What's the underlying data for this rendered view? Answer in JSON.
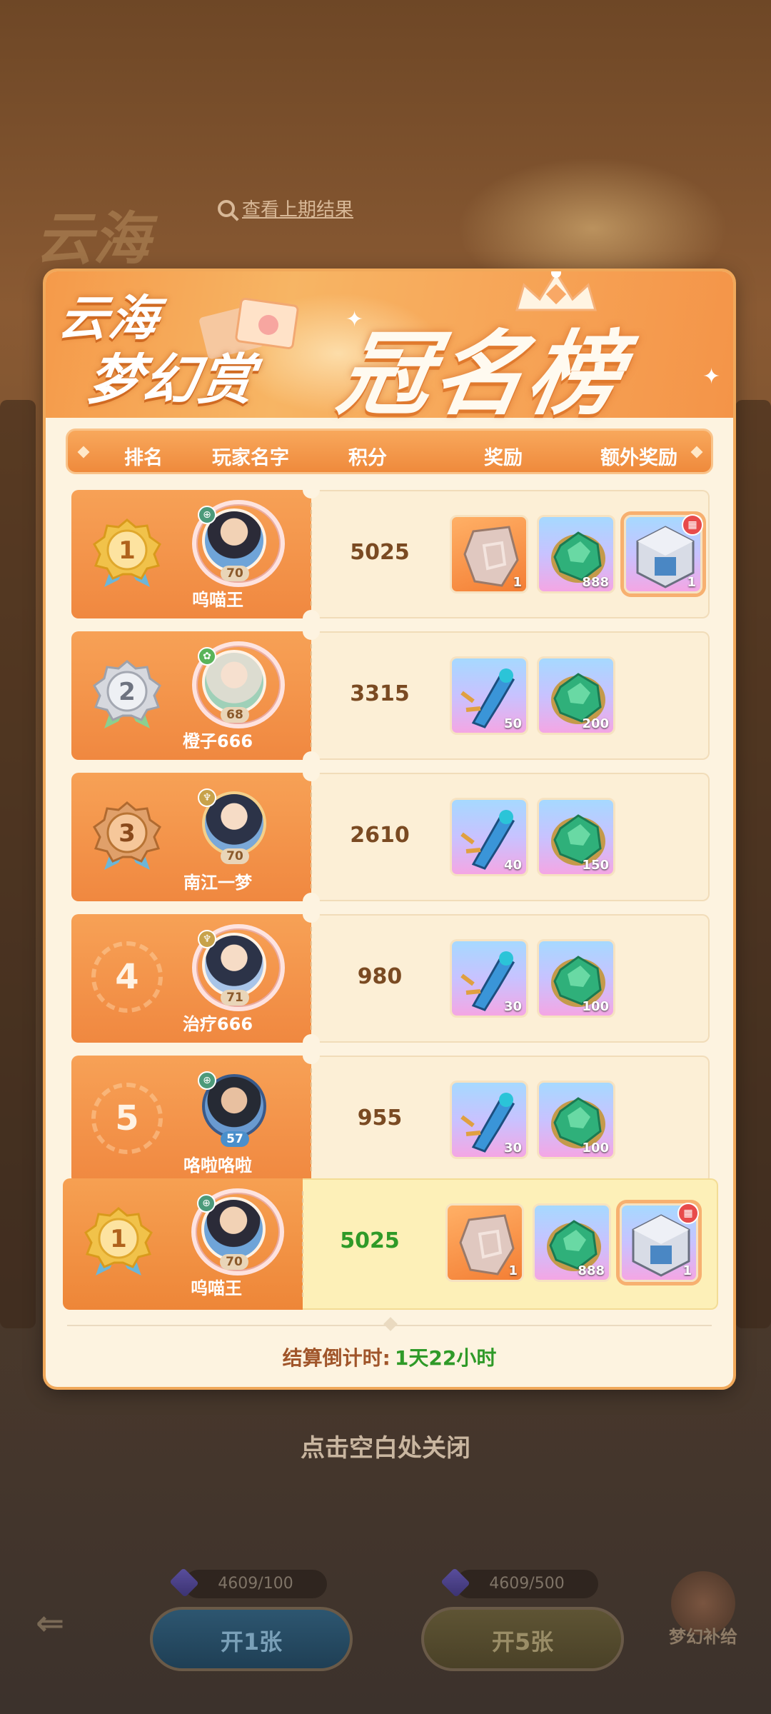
{
  "background": {
    "title": "云海",
    "history_link": "查看上期结果"
  },
  "banner": {
    "line1": "云海",
    "line2": "梦幻赏",
    "main": "冠名榜"
  },
  "table": {
    "headers": [
      "排名",
      "玩家名字",
      "积分",
      "奖励",
      "额外奖励"
    ]
  },
  "rows": [
    {
      "rank": "1",
      "name": "呜喵王",
      "level": "70",
      "score": "5025",
      "rewards": [
        {
          "icon": "rune-stone-icon",
          "qty": "1",
          "bg": "orange"
        },
        {
          "icon": "emerald-gem-icon",
          "qty": "888",
          "bg": "purple"
        }
      ],
      "extra": {
        "icon": "mecha-cube-icon",
        "qty": "1",
        "bg": "purple"
      }
    },
    {
      "rank": "2",
      "name": "橙子666",
      "level": "68",
      "score": "3315",
      "rewards": [
        {
          "icon": "mecha-claw-icon",
          "qty": "50",
          "bg": "purple"
        },
        {
          "icon": "emerald-gem-icon",
          "qty": "200",
          "bg": "purple"
        }
      ]
    },
    {
      "rank": "3",
      "name": "南江一梦",
      "level": "70",
      "score": "2610",
      "rewards": [
        {
          "icon": "mecha-claw-icon",
          "qty": "40",
          "bg": "purple"
        },
        {
          "icon": "emerald-gem-icon",
          "qty": "150",
          "bg": "purple"
        }
      ]
    },
    {
      "rank": "4",
      "name": "治疗666",
      "level": "71",
      "score": "980",
      "rewards": [
        {
          "icon": "mecha-claw-icon",
          "qty": "30",
          "bg": "purple"
        },
        {
          "icon": "emerald-gem-icon",
          "qty": "100",
          "bg": "purple"
        }
      ]
    },
    {
      "rank": "5",
      "name": "咯啦咯啦",
      "level": "57",
      "score": "955",
      "rewards": [
        {
          "icon": "mecha-claw-icon",
          "qty": "30",
          "bg": "purple"
        },
        {
          "icon": "emerald-gem-icon",
          "qty": "100",
          "bg": "purple"
        }
      ]
    }
  ],
  "my_row": {
    "rank": "1",
    "name": "呜喵王",
    "level": "70",
    "score": "5025",
    "rewards": [
      {
        "qty": "1"
      },
      {
        "qty": "888"
      }
    ],
    "extra_qty": "1"
  },
  "countdown": {
    "label": "结算倒计时:",
    "value": "1天22小时"
  },
  "close_hint": "点击空白处关闭",
  "bottom": {
    "counter1": "4609/100",
    "counter2": "4609/500",
    "btn1": "开1张",
    "btn2": "开5张",
    "side": "梦幻补给"
  },
  "colors": {
    "accent": "#f08840",
    "score_highlight": "#2f9a28",
    "panel_bg": "#fdf3e0"
  }
}
